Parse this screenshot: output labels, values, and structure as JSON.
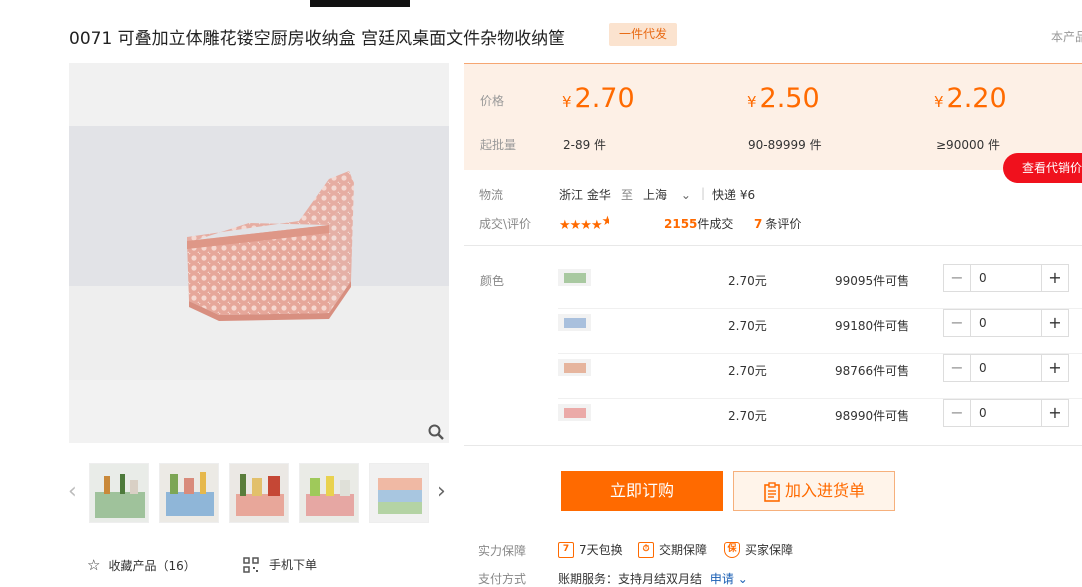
{
  "header": {
    "title": "0071 可叠加立体雕花镂空厨房收纳盒 宫廷风桌面文件杂物收纳筐",
    "badge": "一件代发",
    "corner_text": "本产品"
  },
  "gallery": {
    "thumbnail_count": 5,
    "favorite_label": "收藏产品（16）",
    "mobile_order_label": "手机下单"
  },
  "price_panel": {
    "price_label": "价格",
    "moq_label": "起批量",
    "currency": "¥",
    "tiers": [
      {
        "price": "2.70",
        "moq": "2-89 件"
      },
      {
        "price": "2.50",
        "moq": "90-89999 件"
      },
      {
        "price": "2.20",
        "moq": "≥90000 件"
      }
    ],
    "agent_price_button": "查看代销价"
  },
  "logistics": {
    "label": "物流",
    "from": "浙江 金华",
    "to_label": "至",
    "to": "上海",
    "shipping": "快递 ¥6"
  },
  "sales": {
    "label": "成交\\评价",
    "rating": 4.5,
    "deals_count": "2155",
    "deals_suffix": "件成交",
    "reviews_count": "7",
    "reviews_suffix": "条评价"
  },
  "sku": {
    "label": "颜色",
    "rows": [
      {
        "price": "2.70元",
        "stock": "99095件可售",
        "qty": "0",
        "color": "#a9c9a1"
      },
      {
        "price": "2.70元",
        "stock": "99180件可售",
        "qty": "0",
        "color": "#a9c0dd"
      },
      {
        "price": "2.70元",
        "stock": "98766件可售",
        "qty": "0",
        "color": "#e6b59e"
      },
      {
        "price": "2.70元",
        "stock": "98990件可售",
        "qty": "0",
        "color": "#ebaaa8"
      }
    ]
  },
  "actions": {
    "buy_now": "立即订购",
    "add_to_cart": "加入进货单"
  },
  "guarantee": {
    "label": "实力保障",
    "items": [
      "7天包换",
      "交期保障",
      "买家保障"
    ]
  },
  "payment": {
    "label": "支付方式",
    "text": "账期服务：支持月结双月结",
    "link": "申请"
  },
  "colors": {
    "accent": "#ff6a00",
    "agent_red": "#f0111d"
  }
}
